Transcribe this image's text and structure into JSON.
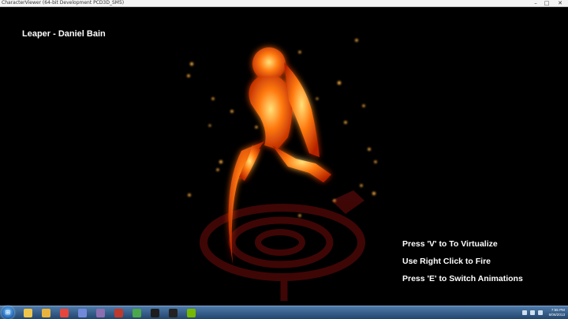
{
  "window": {
    "title": "CharacterViewer (64-bit Development PCD3D_SM5)"
  },
  "window_controls": {
    "minimize": "–",
    "maximize": "□",
    "close": "✕"
  },
  "viewport": {
    "title": "Leaper - Daniel Bain",
    "instructions": [
      "Press 'V' to To Virtualize",
      "Use Right Click to Fire",
      "Press 'E' to Switch Animations"
    ]
  },
  "taskbar": {
    "start_glyph": "⊞",
    "apps": [
      {
        "icon": "file-explorer-icon",
        "color": "#f0c64a"
      },
      {
        "icon": "folder-icon",
        "color": "#e9b33c"
      },
      {
        "icon": "chrome-icon",
        "color": "#e7463c"
      },
      {
        "icon": "discord-icon",
        "color": "#7289da"
      },
      {
        "icon": "game-icon",
        "color": "#8c6fb0"
      },
      {
        "icon": "photo-icon",
        "color": "#c0392b"
      },
      {
        "icon": "media-icon",
        "color": "#4aa84a"
      },
      {
        "icon": "unreal-engine-icon",
        "color": "#1e1e1e"
      },
      {
        "icon": "character-viewer-icon",
        "color": "#222"
      },
      {
        "icon": "nvidia-icon",
        "color": "#76b900"
      }
    ],
    "clock": {
      "time": "7:55 PM",
      "date": "6/06/2013"
    }
  },
  "colors": {
    "glow": "#ff7a10",
    "core": "#ffd060",
    "emblem": "#5a0a0a"
  }
}
